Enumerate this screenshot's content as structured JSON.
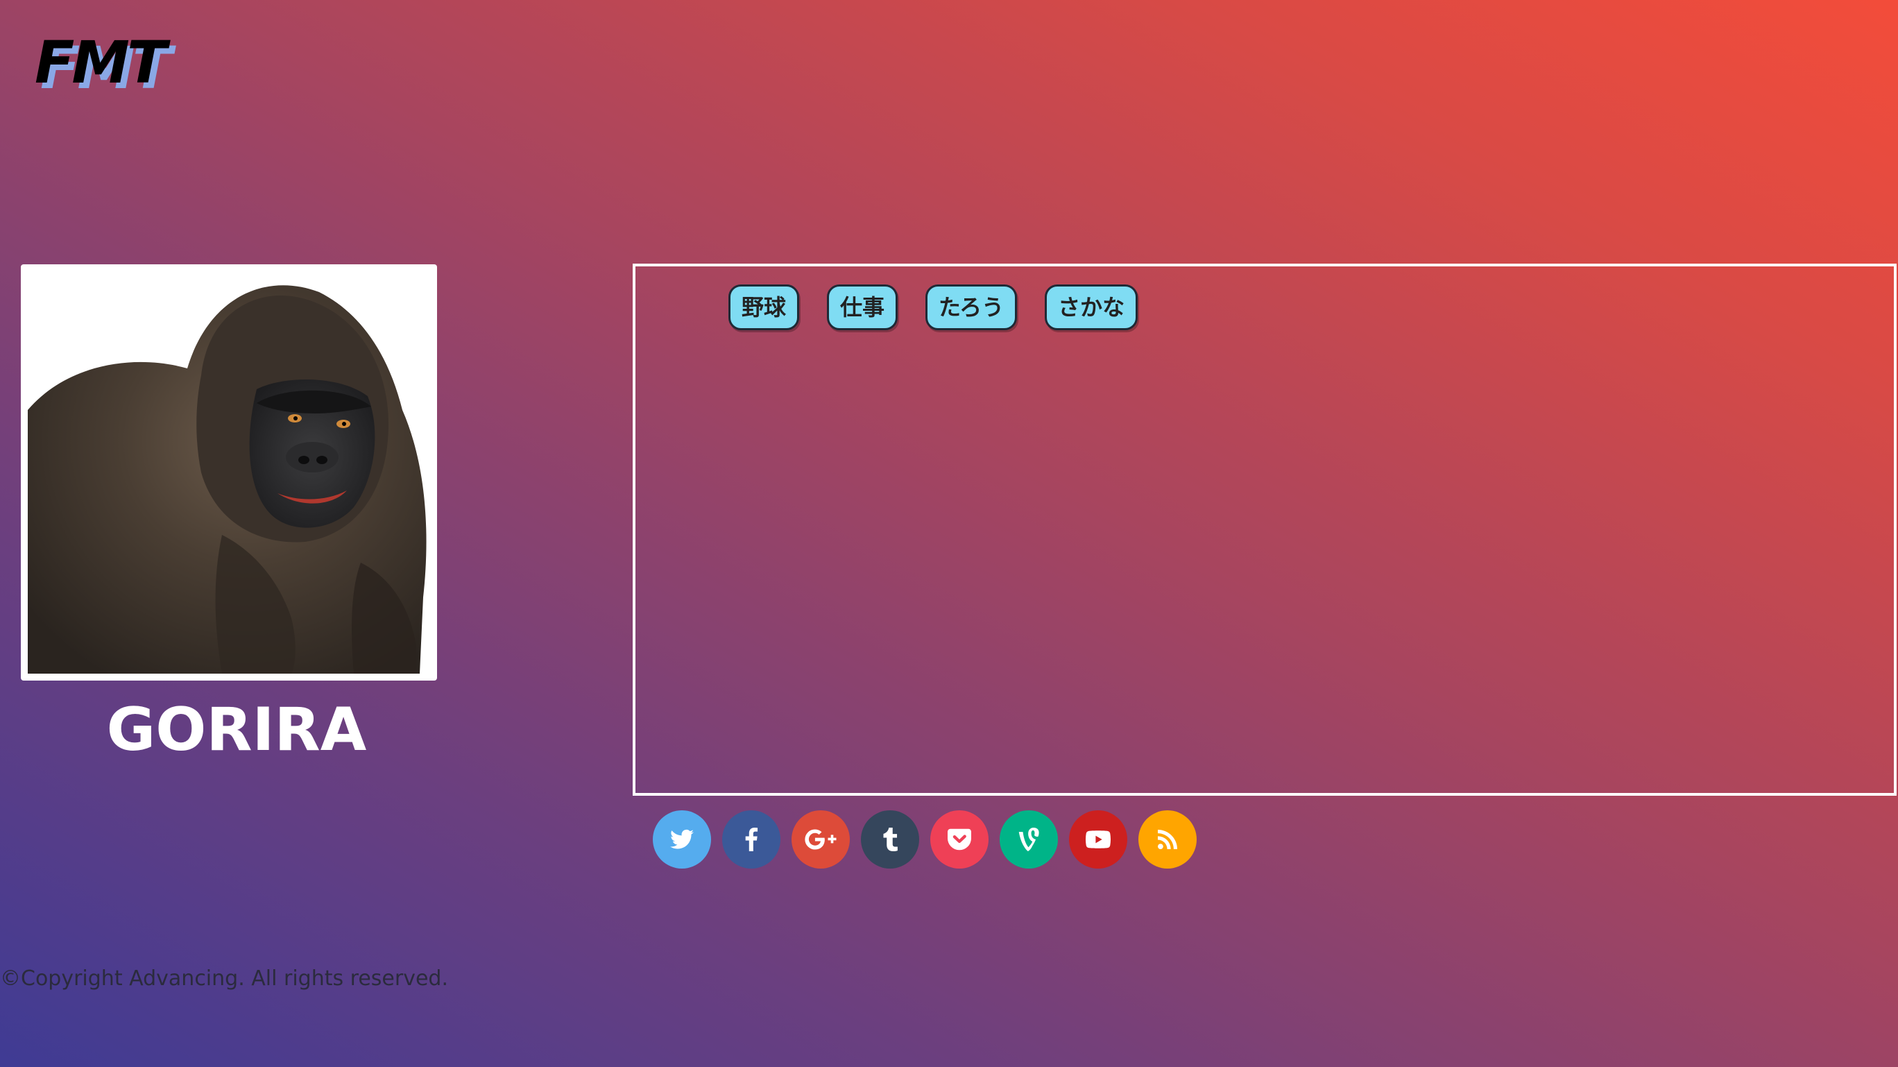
{
  "logo": {
    "text": "FMT"
  },
  "profile": {
    "name": "GORIRA",
    "image_alt": "gorilla photo"
  },
  "tags": [
    {
      "label": "野球"
    },
    {
      "label": "仕事"
    },
    {
      "label": "たろう"
    },
    {
      "label": "さかな"
    }
  ],
  "social": [
    {
      "name": "twitter",
      "icon": "twitter-icon",
      "color": "#55acee"
    },
    {
      "name": "facebook",
      "icon": "facebook-icon",
      "color": "#3b5998"
    },
    {
      "name": "google-plus",
      "icon": "google-plus-icon",
      "color": "#dd4b39"
    },
    {
      "name": "tumblr",
      "icon": "tumblr-icon",
      "color": "#35465c"
    },
    {
      "name": "pocket",
      "icon": "pocket-icon",
      "color": "#ef4056"
    },
    {
      "name": "vine",
      "icon": "vine-icon",
      "color": "#00b488"
    },
    {
      "name": "youtube",
      "icon": "youtube-icon",
      "color": "#cd201f"
    },
    {
      "name": "rss",
      "icon": "rss-icon",
      "color": "#ffa500"
    }
  ],
  "footer": {
    "copyright": "©Copyright Advancing. All rights reserved."
  },
  "colors": {
    "tag_bg": "#7fdcf3",
    "gradient_start": "#3f3b94",
    "gradient_end": "#f34c3a"
  }
}
